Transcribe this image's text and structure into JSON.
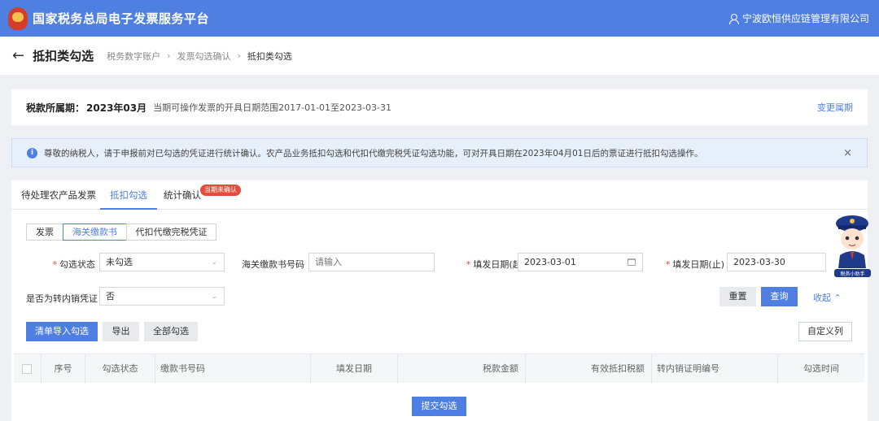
{
  "header": {
    "app_title": "国家税务总局电子发票服务平台",
    "org_name": "宁波欧恒供应链管理有限公司"
  },
  "titlebar": {
    "title": "抵扣类勾选",
    "breadcrumbs": [
      "税务数字账户",
      "发票勾选确认",
      "抵扣类勾选"
    ]
  },
  "period": {
    "label": "税款所属期：",
    "value": "2023年03月",
    "range_text": "当期可操作发票的开具日期范围2017-01-01至2023-03-31",
    "change_link": "变更属期"
  },
  "notice": {
    "text": "尊敬的纳税人，请于申报前对已勾选的凭证进行统计确认。农产品业务抵扣勾选和代扣代缴完税凭证勾选功能，可对开具日期在2023年04月01日后的票证进行抵扣勾选操作。"
  },
  "tabs": [
    {
      "label": "待处理农产品发票"
    },
    {
      "label": "抵扣勾选"
    },
    {
      "label": "统计确认"
    }
  ],
  "tab_badge": "当期未确认",
  "segments": [
    {
      "label": "发票"
    },
    {
      "label": "海关缴款书"
    },
    {
      "label": "代扣代缴完税凭证"
    }
  ],
  "filters": {
    "status_label": "勾选状态",
    "status_value": "未勾选",
    "number_label": "海关缴款书号码",
    "number_placeholder": "请输入",
    "date_start_label": "填发日期(起)",
    "date_start_value": "2023-03-01",
    "date_end_label": "填发日期(止)",
    "date_end_value": "2023-03-30",
    "transfer_label": "是否为转内销凭证",
    "transfer_value": "否"
  },
  "actions": {
    "reset": "重置",
    "search": "查询",
    "collapse": "收起",
    "import_select": "清单导入勾选",
    "export": "导出",
    "select_all": "全部勾选",
    "custom_columns": "自定义列",
    "submit": "提交勾选"
  },
  "table": {
    "columns": [
      "序号",
      "勾选状态",
      "缴款书号码",
      "填发日期",
      "税款金额",
      "有效抵扣税额",
      "转内销证明编号",
      "勾选时间"
    ]
  },
  "mascot": {
    "caption": "税务小助手"
  }
}
